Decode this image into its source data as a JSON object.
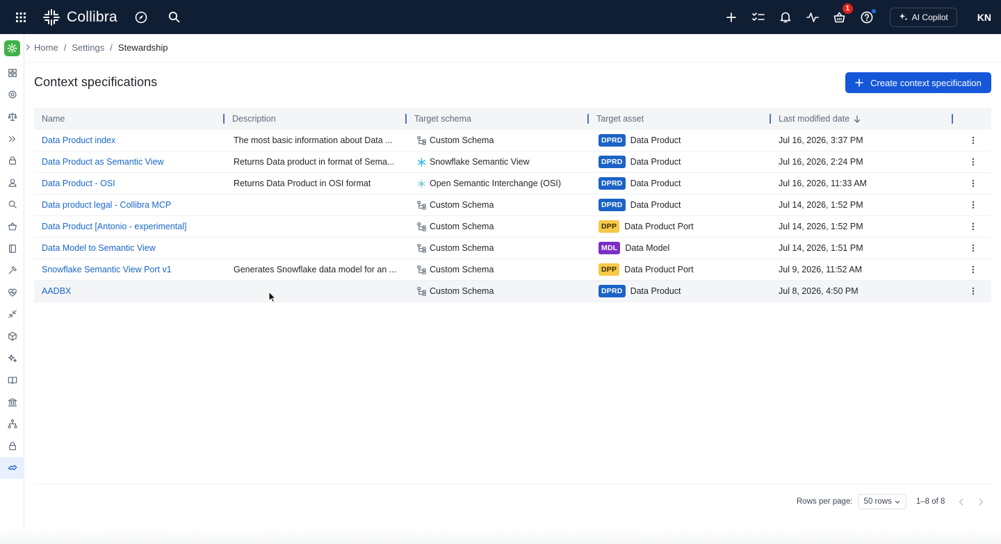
{
  "app": {
    "brand": "Collibra",
    "copilot_label": "AI Copilot",
    "user_initials": "KN",
    "notification_count": "1"
  },
  "breadcrumb": [
    "Home",
    "Settings",
    "Stewardship"
  ],
  "page": {
    "title": "Context specifications",
    "create_button": "Create context specification"
  },
  "table": {
    "columns": [
      "Name",
      "Description",
      "Target schema",
      "Target asset",
      "Last modified date"
    ],
    "sort": {
      "column": "Last modified date",
      "direction": "desc"
    },
    "rows": [
      {
        "name": "Data Product index",
        "description": "The most basic information about Data ...",
        "schema": "Custom Schema",
        "schema_icon": "schema-icon",
        "asset_tag": "DPRD",
        "asset": "Data Product",
        "modified": "Jul 16, 2026, 3:37 PM"
      },
      {
        "name": "Data Product as Semantic View",
        "description": "Returns Data product in format of Sema...",
        "schema": "Snowflake Semantic View",
        "schema_icon": "snowflake-icon",
        "asset_tag": "DPRD",
        "asset": "Data Product",
        "modified": "Jul 16, 2026, 2:24 PM"
      },
      {
        "name": "Data Product - OSI",
        "description": "Returns Data Product in OSI format",
        "schema": "Open Semantic Interchange (OSI)",
        "schema_icon": "osi-icon",
        "asset_tag": "DPRD",
        "asset": "Data Product",
        "modified": "Jul 16, 2026, 11:33 AM"
      },
      {
        "name": "Data product legal - Collibra MCP",
        "description": "",
        "schema": "Custom Schema",
        "schema_icon": "schema-icon",
        "asset_tag": "DPRD",
        "asset": "Data Product",
        "modified": "Jul 14, 2026, 1:52 PM"
      },
      {
        "name": "Data Product [Antonio - experimental]",
        "description": "",
        "schema": "Custom Schema",
        "schema_icon": "schema-icon",
        "asset_tag": "DPP",
        "asset": "Data Product Port",
        "modified": "Jul 14, 2026, 1:52 PM"
      },
      {
        "name": "Data Model to Semantic View",
        "description": "",
        "schema": "Custom Schema",
        "schema_icon": "schema-icon",
        "asset_tag": "MDL",
        "asset": "Data Model",
        "modified": "Jul 14, 2026, 1:51 PM"
      },
      {
        "name": "Snowflake Semantic View Port v1",
        "description": "Generates Snowflake data model for an ...",
        "schema": "Custom Schema",
        "schema_icon": "schema-icon",
        "asset_tag": "DPP",
        "asset": "Data Product Port",
        "modified": "Jul 9, 2026, 11:52 AM"
      },
      {
        "name": "AADBX",
        "description": "",
        "schema": "Custom Schema",
        "schema_icon": "schema-icon",
        "asset_tag": "DPRD",
        "asset": "Data Product",
        "modified": "Jul 8, 2026, 4:50 PM"
      }
    ]
  },
  "tag_colors": {
    "DPRD": {
      "bg": "#1b63c6",
      "fg": "#ffffff"
    },
    "DPP": {
      "bg": "#f7c948",
      "fg": "#3a2d00"
    },
    "MDL": {
      "bg": "#7b2fc9",
      "fg": "#ffffff"
    }
  },
  "footer": {
    "rows_per_page_label": "Rows per page:",
    "rows_per_page_value": "50 rows",
    "range": "1–8 of 8"
  },
  "rail_icons": [
    "dashboard-icon",
    "settings-icon",
    "scales-icon",
    "chevrons-right-icon",
    "lock-icon",
    "user-icon",
    "search-icon",
    "basket-icon",
    "book-icon",
    "gavel-icon",
    "heart-pulse-icon",
    "compress-icon",
    "cube-icon",
    "sparkles-icon",
    "open-book-icon",
    "bank-icon",
    "hierarchy-icon",
    "lock-icon",
    "handshake-icon"
  ],
  "colors": {
    "topbar": "#101e33",
    "accent": "#1457d9",
    "link": "#1a66c8",
    "brand_green": "#41b147"
  }
}
